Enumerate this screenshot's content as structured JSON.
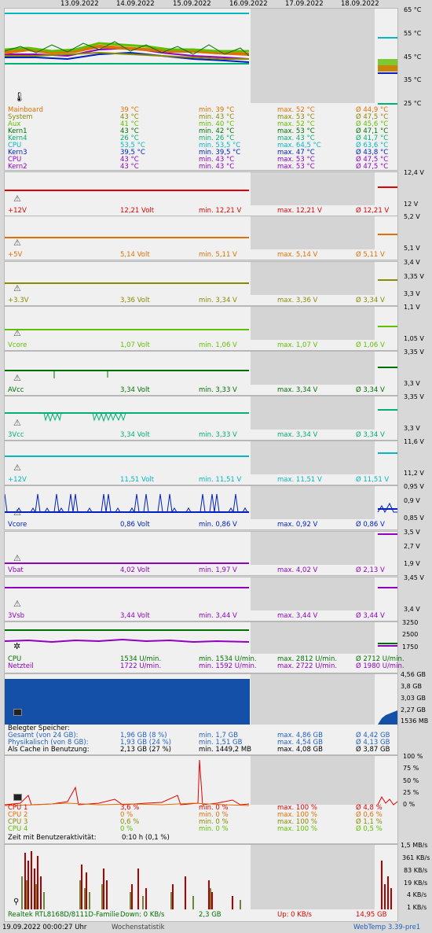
{
  "dates": [
    "13.09.2022",
    "14.09.2022",
    "15.09.2022",
    "16.09.2022",
    "17.09.2022",
    "18.09.2022"
  ],
  "colors": {
    "red": "#e00000",
    "orange": "#e07000",
    "olive": "#8a8a00",
    "lime": "#60c000",
    "green": "#007000",
    "teal": "#00b070",
    "cyan": "#00b8c0",
    "blue": "#0020c0",
    "purple": "#9000c0",
    "gray": "#808080"
  },
  "temps": {
    "axis": [
      "65 °C",
      "55 °C",
      "45 °C",
      "35 °C",
      "25 °C"
    ],
    "rows": [
      {
        "name": "Mainboard",
        "cur": "39 °C",
        "min": "min. 39 °C",
        "max": "max. 52 °C",
        "avg": "Ø 44,9 °C",
        "color": "#e07000"
      },
      {
        "name": "System",
        "cur": "43 °C",
        "min": "min. 43 °C",
        "max": "max. 53 °C",
        "avg": "Ø 47,5 °C",
        "color": "#8a8a00"
      },
      {
        "name": "Aux",
        "cur": "41 °C",
        "min": "min. 40 °C",
        "max": "max. 52 °C",
        "avg": "Ø 45,6 °C",
        "color": "#60c000"
      },
      {
        "name": "Kern1",
        "cur": "43 °C",
        "min": "min. 42 °C",
        "max": "max. 53 °C",
        "avg": "Ø 47,1 °C",
        "color": "#007000"
      },
      {
        "name": "Kern4",
        "cur": "26 °C",
        "min": "min. 26 °C",
        "max": "max. 43 °C",
        "avg": "Ø 41,7 °C",
        "color": "#00b070"
      },
      {
        "name": "CPU",
        "cur": "53,5 °C",
        "min": "min. 53,5 °C",
        "max": "max. 64,5 °C",
        "avg": "Ø 63,6 °C",
        "color": "#00b8c0"
      },
      {
        "name": "Kern3",
        "cur": "39,5 °C",
        "min": "min. 39,5 °C",
        "max": "max. 47 °C",
        "avg": "Ø 43,8 °C",
        "color": "#0020c0"
      },
      {
        "name": "CPU",
        "cur": "43 °C",
        "min": "min. 43 °C",
        "max": "max. 53 °C",
        "avg": "Ø 47,5 °C",
        "color": "#9000c0"
      },
      {
        "name": "Kern2",
        "cur": "43 °C",
        "min": "min. 43 °C",
        "max": "max. 53 °C",
        "avg": "Ø 47,5 °C",
        "color": "#9000c0"
      }
    ]
  },
  "volts": [
    {
      "name": "+12V",
      "cur": "12,21 Volt",
      "min": "min. 12,21 V",
      "max": "max. 12,21 V",
      "avg": "Ø 12,21 V",
      "color": "#e00000",
      "top": "12,4 V",
      "bot": "12 V"
    },
    {
      "name": "+5V",
      "cur": "5,14 Volt",
      "min": "min. 5,11 V",
      "max": "max. 5,14 V",
      "avg": "Ø 5,11 V",
      "color": "#e07000",
      "top": "5,2 V",
      "bot": "5,1 V"
    },
    {
      "name": "+3.3V",
      "cur": "3,36 Volt",
      "min": "min. 3,34 V",
      "max": "max. 3,36 V",
      "avg": "Ø 3,34 V",
      "color": "#8a8a00",
      "top": "3,4 V",
      "mid": "3,35 V",
      "bot": "3,3 V"
    },
    {
      "name": "Vcore",
      "cur": "1,07 Volt",
      "min": "min. 1,06 V",
      "max": "max. 1,07 V",
      "avg": "Ø 1,06 V",
      "color": "#60c000",
      "top": "1,1 V",
      "bot": "1,05 V"
    },
    {
      "name": "AVcc",
      "cur": "3,34 Volt",
      "min": "min. 3,33 V",
      "max": "max. 3,34 V",
      "avg": "Ø 3,34 V",
      "color": "#007000",
      "top": "3,35 V",
      "bot": "3,3 V"
    },
    {
      "name": "3Vcc",
      "cur": "3,34 Volt",
      "min": "min. 3,33 V",
      "max": "max. 3,34 V",
      "avg": "Ø 3,34 V",
      "color": "#00b070",
      "top": "3,35 V",
      "bot": "3,3 V"
    },
    {
      "name": "+12V",
      "cur": "11,51 Volt",
      "min": "min. 11,51 V",
      "max": "max. 11,51 V",
      "avg": "Ø 11,51 V",
      "color": "#00b8c0",
      "top": "11,6 V",
      "bot": "11,2 V"
    },
    {
      "name": "Vcore",
      "cur": "0,86 Volt",
      "min": "min. 0,86 V",
      "max": "max. 0,92 V",
      "avg": "Ø 0,86 V",
      "color": "#0020c0",
      "top": "0,95 V",
      "mid": "0,9 V",
      "bot": "0,85 V"
    },
    {
      "name": "Vbat",
      "cur": "4,02 Volt",
      "min": "min. 1,97 V",
      "max": "max. 4,02 V",
      "avg": "Ø 2,13 V",
      "color": "#9000c0",
      "top": "3,5 V",
      "mid": "2,7 V",
      "bot": "1,9 V"
    },
    {
      "name": "3Vsb",
      "cur": "3,44 Volt",
      "min": "min. 3,44 V",
      "max": "max. 3,44 V",
      "avg": "Ø 3,44 V",
      "color": "#9000c0",
      "top": "3,45 V",
      "bot": "3,4 V"
    }
  ],
  "fans": {
    "axis": [
      "3250",
      "2500",
      "1750"
    ],
    "rows": [
      {
        "name": "CPU",
        "cur": "1534 U/min.",
        "min": "min. 1534 U/min.",
        "max": "max. 2812 U/min.",
        "avg": "Ø 2712 U/min.",
        "color": "#007000"
      },
      {
        "name": "Netzteil",
        "cur": "1722 U/min.",
        "min": "min. 1592 U/min.",
        "max": "max. 2722 U/min.",
        "avg": "Ø 1980 U/min.",
        "color": "#9000c0"
      }
    ]
  },
  "memory": {
    "axis": [
      "4,56 GB",
      "3,8 GB",
      "3,03 GB",
      "2,27 GB",
      "1536 MB"
    ],
    "title": "Belegter Speicher:",
    "rows": [
      {
        "name": "Gesamt (von 24 GB):",
        "cur": "1,96 GB (8 %)",
        "min": "min. 1,7 GB",
        "max": "max. 4,86 GB",
        "avg": "Ø 4,42 GB",
        "color": "#2060c0"
      },
      {
        "name": "Physikalisch (von 8 GB):",
        "cur": "1,93 GB (24 %)",
        "min": "min. 1,51 GB",
        "max": "max. 4,54 GB",
        "avg": "Ø 4,13 GB",
        "color": "#2060c0"
      },
      {
        "name": "Als Cache in Benutzung:",
        "cur": "2,13 GB (27 %)",
        "min": "min. 1449,2 MB",
        "max": "max. 4,08 GB",
        "avg": "Ø 3,87 GB",
        "color": "#000000"
      }
    ]
  },
  "cpu": {
    "axis": [
      "100 %",
      "75 %",
      "50 %",
      "25 %",
      "0 %"
    ],
    "rows": [
      {
        "name": "CPU 1",
        "cur": "3,6 %",
        "min": "min. 0 %",
        "max": "max. 100 %",
        "avg": "Ø 4,8 %",
        "color": "#e00000"
      },
      {
        "name": "CPU 2",
        "cur": "0 %",
        "min": "min. 0 %",
        "max": "max. 100 %",
        "avg": "Ø 0,6 %",
        "color": "#e07000"
      },
      {
        "name": "CPU 3",
        "cur": "0,6 %",
        "min": "min. 0 %",
        "max": "max. 100 %",
        "avg": "Ø 1,1 %",
        "color": "#8a8a00"
      },
      {
        "name": "CPU 4",
        "cur": "0 %",
        "min": "min. 0 %",
        "max": "max. 100 %",
        "avg": "Ø 0,5 %",
        "color": "#60c000"
      }
    ],
    "useractivity_label": "Zeit mit Benutzeraktivität:",
    "useractivity_value": "0:10 h (0,1 %)"
  },
  "net": {
    "axis": [
      "1,5 MB/s",
      "361 KB/s",
      "83 KB/s",
      "19 KB/s",
      "4 KB/s",
      "1 KB/s"
    ],
    "adapter": "Realtek RTL8168D/8111D-Familie",
    "down": "Down: 0 KB/s",
    "down_total": "2,3 GB",
    "up": "Up: 0 KB/s",
    "up_total": "14,95 GB"
  },
  "footer": {
    "timestamp": "19.09.2022 00:00:27 Uhr",
    "mode": "Wochenstatistik",
    "app": "WebTemp 3.39-pre1"
  }
}
